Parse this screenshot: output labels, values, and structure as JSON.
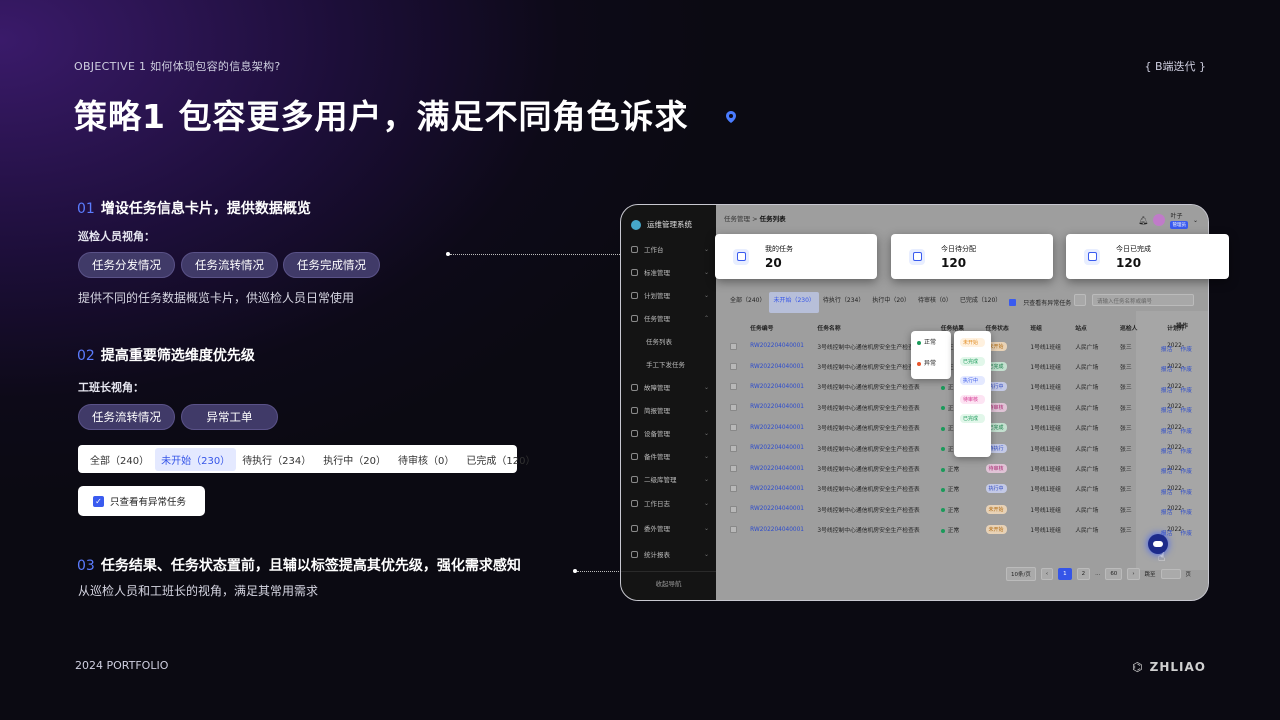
{
  "header": {
    "objective": "OBJECTIVE 1 如何体现包容的信息架构?",
    "tag": "{ B端迭代 }",
    "title": "策略1 包容更多用户，满足不同角色诉求"
  },
  "sections": [
    {
      "num": "01",
      "title": "增设任务信息卡片，提供数据概览",
      "role": "巡检人员视角：",
      "pills": [
        "任务分发情况",
        "任务流转情况",
        "任务完成情况"
      ],
      "desc": "提供不同的任务数据概览卡片，供巡检人员日常使用"
    },
    {
      "num": "02",
      "title": "提高重要筛选维度优先级",
      "role": "工班长视角：",
      "pills": [
        "任务流转情况",
        "异常工单"
      ]
    },
    {
      "num": "03",
      "title": "任务结果、任务状态置前，且辅以标签提高其优先级，强化需求感知",
      "desc": "从巡检人员和工班长的视角，满足其常用需求"
    }
  ],
  "filter_tabs": [
    "全部（240）",
    "未开始（230）",
    "待执行（234）",
    "执行中（20）",
    "待审核（0）",
    "已完成（120）"
  ],
  "filter_active": 1,
  "only_abnormal": "只查看有异常任务",
  "footer": {
    "left": "2024 PORTFOLIO",
    "brand": "ZHLIAO"
  },
  "app": {
    "system_name": "运维管理系统",
    "nav": [
      {
        "label": "工作台",
        "icon": "home-icon"
      },
      {
        "label": "标准管理",
        "icon": "list-icon"
      },
      {
        "label": "计划管理",
        "icon": "calendar-icon"
      },
      {
        "label": "任务管理",
        "icon": "target-icon"
      },
      {
        "label": "任务列表",
        "sub": true,
        "selected": true
      },
      {
        "label": "手工下发任务",
        "sub": true
      },
      {
        "label": "故障管理",
        "icon": "wrench-icon"
      },
      {
        "label": "简报管理",
        "icon": "report-icon"
      },
      {
        "label": "设备管理",
        "icon": "device-icon"
      },
      {
        "label": "备件管理",
        "icon": "box-icon"
      },
      {
        "label": "二级库管理",
        "icon": "warehouse-icon"
      },
      {
        "label": "工作日志",
        "icon": "log-icon"
      },
      {
        "label": "委外管理",
        "icon": "users-icon"
      },
      {
        "label": "统计报表",
        "icon": "chart-icon"
      }
    ],
    "collapse": "收起导航",
    "breadcrumb_parent": "任务管理 > ",
    "breadcrumb_current": "任务列表",
    "user_name": "叶子",
    "user_role": "管理员",
    "tabs": [
      "全部（240）",
      "未开始（230）",
      "待执行（234）",
      "执行中（20）",
      "待审核（0）",
      "已完成（120）"
    ],
    "only_abnormal": "只查看有异常任务",
    "search_placeholder": "请输入任务名称或编号",
    "columns": [
      "任务编号",
      "任务名称",
      "任务结果",
      "任务状态",
      "班组",
      "站点",
      "巡检人",
      "计划开",
      "操作"
    ],
    "rows": [
      {
        "code": "RW202204040001",
        "name": "3号线控制中心通信机房安全生产检查表",
        "result": "正常",
        "status": "未开始",
        "team": "1号线1班组",
        "site": "人民广场",
        "person": "张三",
        "date": "2022-"
      },
      {
        "code": "RW202204040001",
        "name": "3号线控制中心通信机房安全生产检查表",
        "result": "正常",
        "status": "已完成",
        "team": "1号线1班组",
        "site": "人民广场",
        "person": "张三",
        "date": "2022-"
      },
      {
        "code": "RW202204040001",
        "name": "3号线控制中心通信机房安全生产检查表",
        "result": "正常",
        "status": "执行中",
        "team": "1号线1班组",
        "site": "人民广场",
        "person": "张三",
        "date": "2022-"
      },
      {
        "code": "RW202204040001",
        "name": "3号线控制中心通信机房安全生产检查表",
        "result": "正常",
        "status": "待审核",
        "team": "1号线1班组",
        "site": "人民广场",
        "person": "张三",
        "date": "2022-"
      },
      {
        "code": "RW202204040001",
        "name": "3号线控制中心通信机房安全生产检查表",
        "result": "正常",
        "status": "已完成",
        "team": "1号线1班组",
        "site": "人民广场",
        "person": "张三",
        "date": "2022-"
      },
      {
        "code": "RW202204040001",
        "name": "3号线控制中心通信机房安全生产检查表",
        "result": "正常",
        "status": "待执行",
        "team": "1号线1班组",
        "site": "人民广场",
        "person": "张三",
        "date": "2022-"
      },
      {
        "code": "RW202204040001",
        "name": "3号线控制中心通信机房安全生产检查表",
        "result": "正常",
        "status": "待审核",
        "team": "1号线1班组",
        "site": "人民广场",
        "person": "张三",
        "date": "2022-"
      },
      {
        "code": "RW202204040001",
        "name": "3号线控制中心通信机房安全生产检查表",
        "result": "正常",
        "status": "执行中",
        "team": "1号线1班组",
        "site": "人民广场",
        "person": "张三",
        "date": "2022-"
      },
      {
        "code": "RW202204040001",
        "name": "3号线控制中心通信机房安全生产检查表",
        "result": "正常",
        "status": "未开始",
        "team": "1号线1班组",
        "site": "人民广场",
        "person": "张三",
        "date": "2022-"
      },
      {
        "code": "RW202204040001",
        "name": "3号线控制中心通信机房安全生产检查表",
        "result": "正常",
        "status": "未开始",
        "team": "1号线1班组",
        "site": "人民广场",
        "person": "张三",
        "date": "2022-"
      }
    ],
    "ops": [
      "报活",
      "作废"
    ],
    "result_popover": [
      "正常",
      "异常"
    ],
    "status_popover": [
      "未开始",
      "已完成",
      "执行中",
      "待审核",
      "已完成"
    ],
    "pager": {
      "size": "10条/页",
      "pages": [
        "1",
        "2",
        "...",
        "60"
      ],
      "jump": "跳至",
      "page_unit": "页"
    }
  },
  "stat_cards": [
    {
      "label": "我的任务",
      "value": "20"
    },
    {
      "label": "今日待分配",
      "value": "120"
    },
    {
      "label": "今日已完成",
      "value": "120"
    }
  ],
  "colors": {
    "accent": "#3a5bef",
    "pill_bg": "#403a68",
    "number": "#5b7cff"
  }
}
